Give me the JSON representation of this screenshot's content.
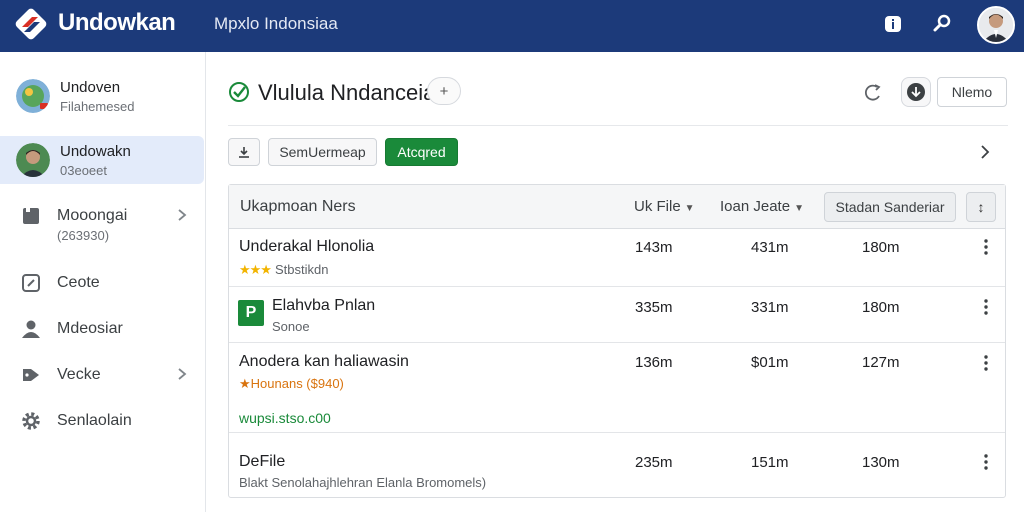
{
  "app": {
    "brand": "Undowkan",
    "nav": "Mpxlo  Indonsiaa"
  },
  "sidebar": {
    "users": [
      {
        "name": "Undoven",
        "sub": "Filahemesed",
        "active": false
      },
      {
        "name": "Undowakn",
        "sub": "03eoeet",
        "active": true
      }
    ],
    "items": [
      {
        "label": "Mooongai",
        "sub": "(263930)",
        "icon": "folder-icon",
        "chevron": true
      },
      {
        "label": "Ceote",
        "icon": "edit-icon",
        "chevron": false
      },
      {
        "label": "Mdeosiar",
        "icon": "person-icon",
        "chevron": false
      },
      {
        "label": "Vecke",
        "icon": "tag-icon",
        "chevron": true
      },
      {
        "label": "Senlaolain",
        "icon": "gear-icon",
        "chevron": false
      }
    ]
  },
  "header": {
    "title": "Vlulula Nndanceia",
    "chip": "+",
    "button": "Nlemo"
  },
  "toolbar": {
    "icon_button": "download-icon",
    "secondary": "SemUermeap",
    "primary": "Atcqred"
  },
  "table": {
    "columns": {
      "name": "Ukapmoan Ners",
      "col1": "Uk File",
      "col2": "Ioan Jeate",
      "button": "Stadan Sanderiar",
      "square_button": "↕"
    },
    "rows": [
      {
        "name": "Underakal Hlonolia",
        "sub": "Stbstikdn",
        "rating": "★★★",
        "c1": "143m",
        "c2": "431m",
        "c3": "180m"
      },
      {
        "name": "Elahvba Pnlan",
        "sub": "Sonoe",
        "icon_letter": "P",
        "c1": "335m",
        "c2": "331m",
        "c3": "180m"
      },
      {
        "name": "Anodera kan haliawasin",
        "sub": "★Hounans ($940)",
        "link": "wupsi.stso.c00",
        "c1": "136m",
        "c2": "$01m",
        "c3": "127m"
      },
      {
        "name": "DeFile",
        "sub": "Blakt Senolahajhlehran Elanla Bromomels)",
        "c1": "235m",
        "c2": "151m",
        "c3": "130m"
      }
    ]
  },
  "colors": {
    "topbar": "#1c3a7a",
    "accent_green": "#1a8a3a",
    "active_row": "#e3ebfa"
  }
}
